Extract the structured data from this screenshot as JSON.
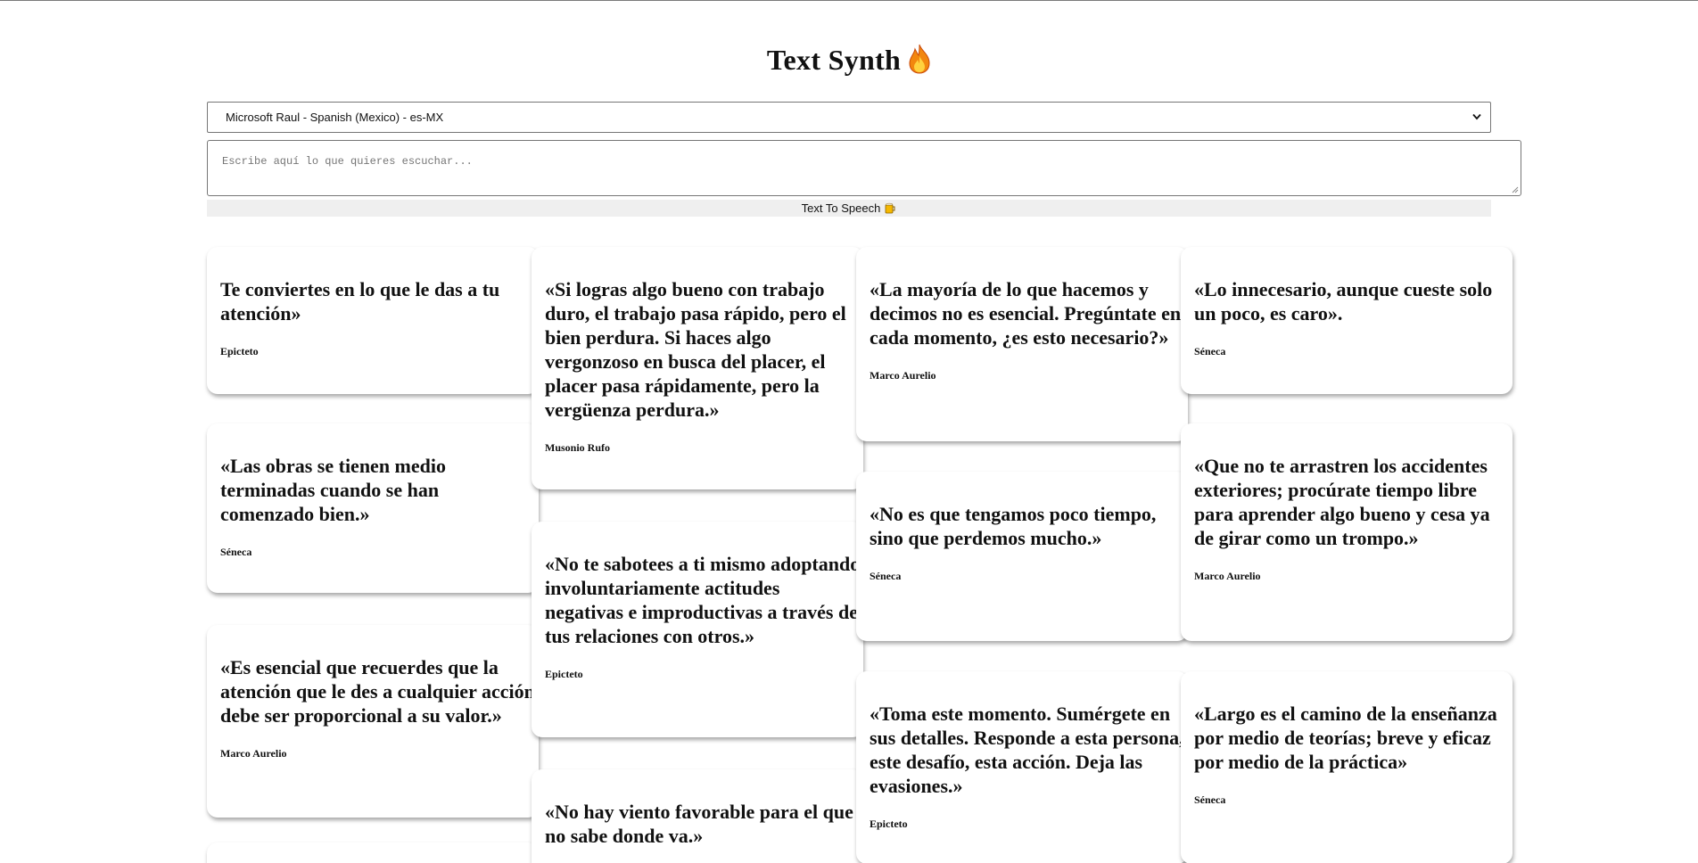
{
  "header": {
    "title": "Text Synth"
  },
  "voice_select": {
    "value": "Microsoft Raul - Spanish (Mexico) - es-MX"
  },
  "text_input": {
    "placeholder": "Escribe aquí lo que quieres escuchar..."
  },
  "tts_button": {
    "label": "Text To Speech"
  },
  "icons": {
    "title": "fire-icon",
    "button": "beer-mug-icon",
    "select": "chevron-down-icon"
  },
  "quotes": [
    {
      "text": "Te conviertes en lo que le das a tu atención»",
      "author": "Epicteto"
    },
    {
      "text": "«Las obras se tienen medio terminadas cuando se han comenzado bien.»",
      "author": "Séneca"
    },
    {
      "text": "«Es esencial que recuerdes que la atención que le des a cualquier acción debe ser proporcional a su valor.»",
      "author": "Marco Aurelio"
    },
    {
      "text": "«Si logras algo bueno con trabajo duro, el trabajo pasa rápido, pero el bien perdura. Si haces algo vergonzoso en busca del placer, el placer pasa rápidamente, pero la vergüenza perdura.»",
      "author": "Musonio Rufo"
    },
    {
      "text": "«No te sabotees a ti mismo adoptando involuntariamente actitudes negativas e improductivas a través de tus relaciones con otros.»",
      "author": "Epicteto"
    },
    {
      "text": "«No hay viento favorable para el que no sabe donde va.»",
      "author": ""
    },
    {
      "text": "«La mayoría de lo que hacemos y decimos no es esencial. Pregúntate en cada momento, ¿es esto necesario?»",
      "author": "Marco Aurelio"
    },
    {
      "text": "«No es que tengamos poco tiempo, sino que perdemos mucho.»",
      "author": "Séneca"
    },
    {
      "text": "«Toma este momento. Sumérgete en sus detalles. Responde a esta persona, este desafío, esta acción. Deja las evasiones.»",
      "author": "Epicteto"
    },
    {
      "text": "«Lo innecesario, aunque cueste solo un poco, es caro».",
      "author": "Séneca"
    },
    {
      "text": "«Que no te arrastren los accidentes exteriores; procúrate tiempo libre para aprender algo bueno y cesa ya de girar como un trompo.»",
      "author": "Marco Aurelio"
    },
    {
      "text": "«Largo es el camino de la enseñanza por medio de teorías; breve y eficaz por medio de la práctica»",
      "author": "Séneca"
    }
  ]
}
